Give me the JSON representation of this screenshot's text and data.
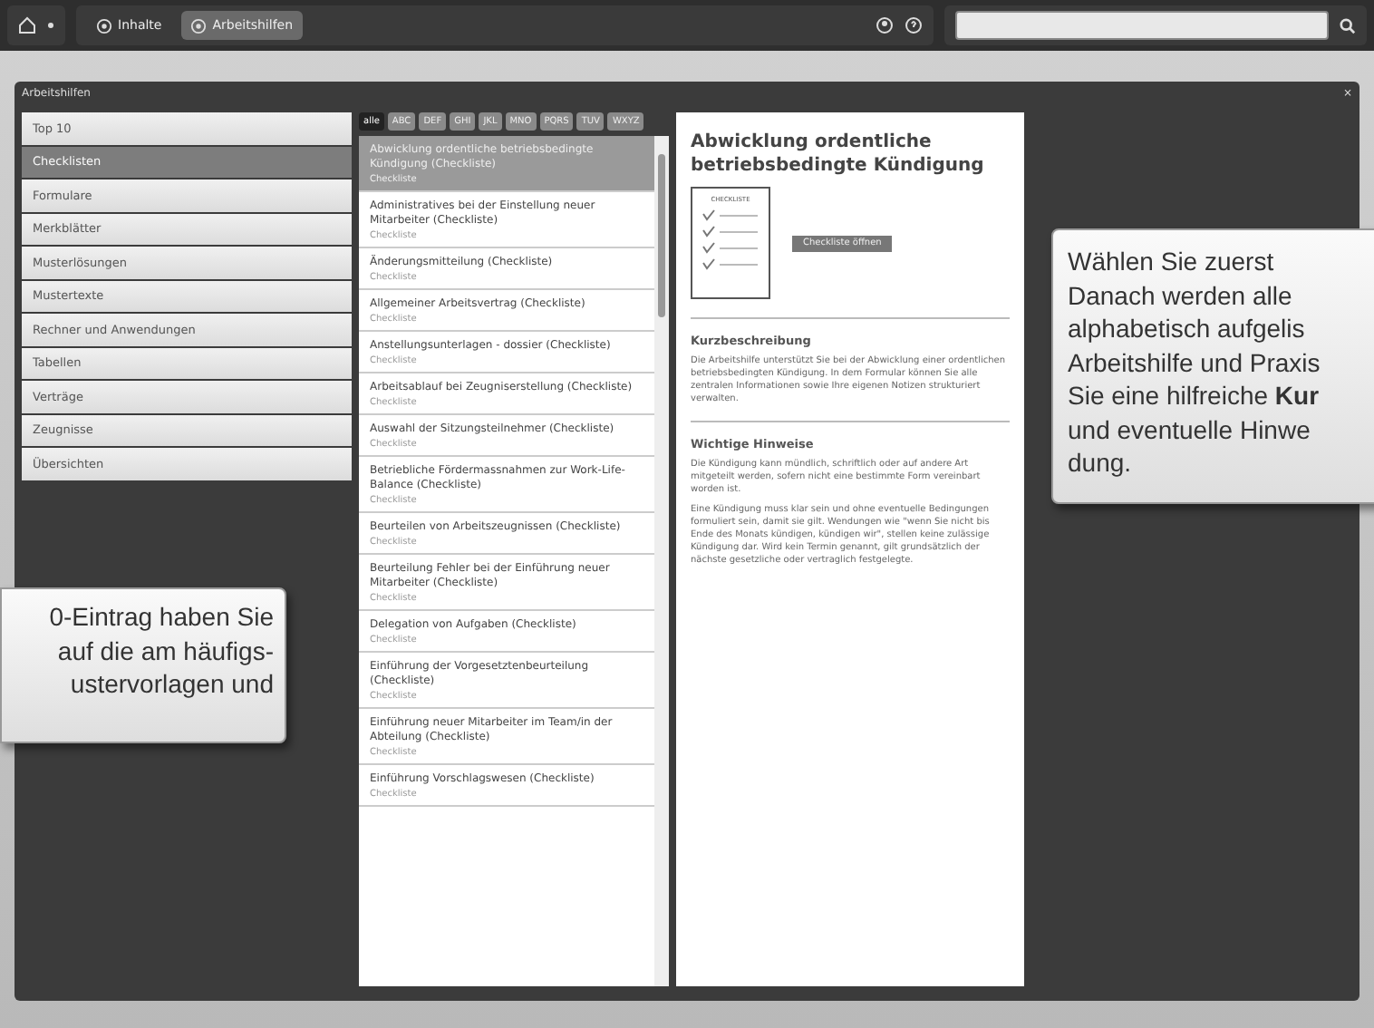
{
  "top_bar": {
    "nav_tabs": [
      {
        "label": "Inhalte",
        "selected": false
      },
      {
        "label": "Arbeitshilfen",
        "selected": true
      }
    ]
  },
  "window": {
    "title": "Arbeitshilfen",
    "close": "×"
  },
  "sidebar": {
    "items": [
      {
        "label": "Top 10",
        "selected": false
      },
      {
        "label": "Checklisten",
        "selected": true
      },
      {
        "label": "Formulare",
        "selected": false
      },
      {
        "label": "Merkblätter",
        "selected": false
      },
      {
        "label": "Musterlösungen",
        "selected": false
      },
      {
        "label": "Mustertexte",
        "selected": false
      },
      {
        "label": "Rechner und Anwendungen",
        "selected": false
      },
      {
        "label": "Tabellen",
        "selected": false
      },
      {
        "label": "Verträge",
        "selected": false
      },
      {
        "label": "Zeugnisse",
        "selected": false
      },
      {
        "label": "Übersichten",
        "selected": false
      }
    ]
  },
  "letter_tabs": [
    {
      "label": "alle",
      "selected": true
    },
    {
      "label": "ABC",
      "selected": false
    },
    {
      "label": "DEF",
      "selected": false
    },
    {
      "label": "GHI",
      "selected": false
    },
    {
      "label": "JKL",
      "selected": false
    },
    {
      "label": "MNO",
      "selected": false
    },
    {
      "label": "PQRS",
      "selected": false
    },
    {
      "label": "TUV",
      "selected": false
    },
    {
      "label": "WXYZ",
      "selected": false
    }
  ],
  "documents": [
    {
      "title": "Abwicklung ordentliche betriebsbedingte Kündigung (Checkliste)",
      "type": "Checkliste",
      "selected": true
    },
    {
      "title": "Administratives bei der Einstellung neuer Mitarbeiter (Checkliste)",
      "type": "Checkliste",
      "selected": false
    },
    {
      "title": "Änderungsmitteilung (Checkliste)",
      "type": "Checkliste",
      "selected": false
    },
    {
      "title": "Allgemeiner Arbeitsvertrag (Checkliste)",
      "type": "Checkliste",
      "selected": false
    },
    {
      "title": "Anstellungsunterlagen - dossier (Checkliste)",
      "type": "Checkliste",
      "selected": false
    },
    {
      "title": "Arbeitsablauf bei Zeugniserstellung (Checkliste)",
      "type": "Checkliste",
      "selected": false
    },
    {
      "title": "Auswahl der Sitzungsteilnehmer (Checkliste)",
      "type": "Checkliste",
      "selected": false
    },
    {
      "title": "Betriebliche Fördermassnahmen zur Work-Life-Balance (Checkliste)",
      "type": "Checkliste",
      "selected": false
    },
    {
      "title": "Beurteilen von Arbeitszeugnissen (Checkliste)",
      "type": "Checkliste",
      "selected": false
    },
    {
      "title": "Beurteilung Fehler bei der Einführung neuer Mitarbeiter (Checkliste)",
      "type": "Checkliste",
      "selected": false
    },
    {
      "title": "Delegation von Aufgaben (Checkliste)",
      "type": "Checkliste",
      "selected": false
    },
    {
      "title": "Einführung der Vorgesetztenbeurteilung (Checkliste)",
      "type": "Checkliste",
      "selected": false
    },
    {
      "title": "Einführung neuer Mitarbeiter im Team/in der Abteilung (Checkliste)",
      "type": "Checkliste",
      "selected": false
    },
    {
      "title": "Einführung Vorschlagswesen (Checkliste)",
      "type": "Checkliste",
      "selected": false
    }
  ],
  "detail": {
    "title": "Abwicklung ordentliche betriebsbedingte Kündigung",
    "thumbnail_label": "CHECKLISTE",
    "open_button": "Checkliste öffnen",
    "sections": [
      {
        "heading": "Kurzbeschreibung",
        "paragraphs": [
          "Die Arbeitshilfe unterstützt Sie bei der Abwicklung einer ordentlichen betriebsbedingten Kündigung. In dem Formular können Sie alle zentralen Informationen sowie Ihre eigenen Notizen strukturiert verwalten."
        ]
      },
      {
        "heading": "Wichtige Hinweise",
        "paragraphs": [
          "Die Kündigung kann mündlich, schriftlich oder auf andere Art mitgeteilt werden, sofern nicht eine bestimmte Form vereinbart worden ist.",
          "Eine Kündigung muss klar sein und ohne eventuelle Bedingungen formuliert sein, damit sie gilt. Wendungen wie \"wenn Sie nicht bis Ende des Monats kündigen, kündigen wir\", stellen keine zulässige Kündigung dar. Wird kein Termin genannt, gilt grundsätzlich der nächste gesetzliche oder vertraglich festgelegte."
        ]
      }
    ]
  },
  "callouts": [
    {
      "lines": [
        "0-Eintrag haben Sie",
        "auf die am häufigs-",
        "ustervorlagen und"
      ]
    },
    {
      "lines": [
        "Wählen Sie zuerst",
        "Danach werden alle",
        "alphabetisch aufgelis",
        "Arbeitshilfe und Praxis",
        "Sie eine hilfreiche **Kur**",
        "und eventuelle Hinwe",
        "dung."
      ]
    }
  ]
}
